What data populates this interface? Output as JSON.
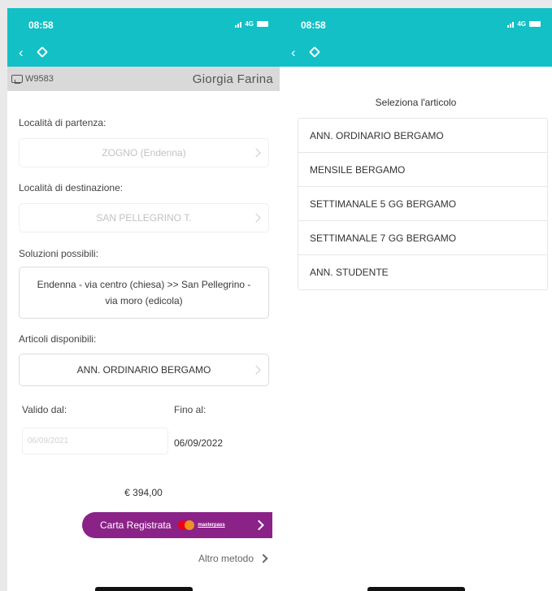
{
  "left_screen": {
    "status": {
      "time": "08:58",
      "network": "4G"
    },
    "user_bar": {
      "id": "W9583",
      "name": "Giorgia Farina"
    },
    "departure": {
      "label": "Località di partenza:",
      "value": "ZOGNO (Endenna)"
    },
    "destination": {
      "label": "Località di destinazione:",
      "value": "SAN PELLEGRINO T."
    },
    "solutions": {
      "label": "Soluzioni possibili:",
      "value": "Endenna - via centro (chiesa) >> San Pellegrino - via moro (edicola)"
    },
    "articles": {
      "label": "Articoli disponibili:",
      "value": "ANN. ORDINARIO BERGAMO"
    },
    "valid_from": {
      "label": "Valido dal:",
      "value": "06/09/2021"
    },
    "valid_to": {
      "label": "Fino al:",
      "value": "06/09/2022"
    },
    "price": "€ 394,00",
    "pay_button": {
      "label": "Carta Registrata",
      "brand": "masterpass"
    },
    "alt_method": "Altro metodo"
  },
  "right_screen": {
    "status": {
      "time": "08:58",
      "network": "4G"
    },
    "title": "Seleziona l'articolo",
    "items": [
      {
        "label": "ANN. ORDINARIO BERGAMO"
      },
      {
        "label": "MENSILE BERGAMO"
      },
      {
        "label": "SETTIMANALE 5 GG BERGAMO"
      },
      {
        "label": "SETTIMANALE 7 GG BERGAMO"
      },
      {
        "label": "ANN. STUDENTE"
      }
    ]
  },
  "colors": {
    "header_teal": "#12c0c6",
    "pay_purple": "#8b2287",
    "user_bar_gray": "#d9d9d9"
  }
}
